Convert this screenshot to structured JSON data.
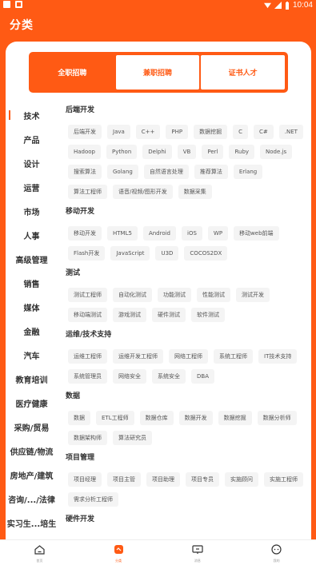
{
  "status_bar": {
    "time": "10:04"
  },
  "header": {
    "title": "分类"
  },
  "tabs": [
    {
      "label": "全职招聘",
      "active": true
    },
    {
      "label": "兼职招聘",
      "active": false
    },
    {
      "label": "证书人才",
      "active": false
    }
  ],
  "sidebar": {
    "items": [
      {
        "label": "技术",
        "active": true
      },
      {
        "label": "产品"
      },
      {
        "label": "设计"
      },
      {
        "label": "运营"
      },
      {
        "label": "市场"
      },
      {
        "label": "人事"
      },
      {
        "label": "高级管理"
      },
      {
        "label": "销售"
      },
      {
        "label": "媒体"
      },
      {
        "label": "金融"
      },
      {
        "label": "汽车"
      },
      {
        "label": "教育培训"
      },
      {
        "label": "医疗健康"
      },
      {
        "label": "采购/贸易"
      },
      {
        "label": "供应链/物流"
      },
      {
        "label": "房地产/建筑"
      },
      {
        "label": "咨询/.../法律"
      },
      {
        "label": "实习生...培生"
      }
    ]
  },
  "sections": [
    {
      "title": "后端开发",
      "tags": [
        "后端开发",
        "Java",
        "C++",
        "PHP",
        "数据挖掘",
        "C",
        "C#",
        ".NET",
        "Hadoop",
        "Python",
        "Delphi",
        "VB",
        "Perl",
        "Ruby",
        "Node.js",
        "搜索算法",
        "Golang",
        "自然语言处理",
        "推荐算法",
        "Erlang",
        "算法工程师",
        "语音/视频/图形开发",
        "数据采集"
      ]
    },
    {
      "title": "移动开发",
      "tags": [
        "移动开发",
        "HTML5",
        "Android",
        "iOS",
        "WP",
        "移动web前端",
        "Flash开发",
        "JavaScript",
        "U3D",
        "COCOS2DX"
      ]
    },
    {
      "title": "测试",
      "tags": [
        "测试工程师",
        "自动化测试",
        "功能测试",
        "性能测试",
        "测试开发",
        "移动端测试",
        "游戏测试",
        "硬件测试",
        "软件测试"
      ]
    },
    {
      "title": "运维/技术支持",
      "tags": [
        "运维工程师",
        "运维开发工程师",
        "网络工程师",
        "系统工程师",
        "IT技术支持",
        "系统管理员",
        "网络安全",
        "系统安全",
        "DBA"
      ]
    },
    {
      "title": "数据",
      "tags": [
        "数据",
        "ETL工程师",
        "数据仓库",
        "数据开发",
        "数据挖掘",
        "数据分析师",
        "数据架构师",
        "算法研究员"
      ]
    },
    {
      "title": "项目管理",
      "tags": [
        "项目经理",
        "项目主管",
        "项目助理",
        "项目专员",
        "实施顾问",
        "实施工程师",
        "需求分析工程师"
      ]
    },
    {
      "title": "硬件开发",
      "tags": []
    }
  ],
  "bottom_nav": [
    {
      "label": "首页",
      "icon": "home-icon",
      "active": false
    },
    {
      "label": "分类",
      "icon": "category-icon",
      "active": true
    },
    {
      "label": "消息",
      "icon": "message-icon",
      "active": false
    },
    {
      "label": "我的",
      "icon": "profile-icon",
      "active": false
    }
  ],
  "colors": {
    "accent": "#ff5a14"
  }
}
